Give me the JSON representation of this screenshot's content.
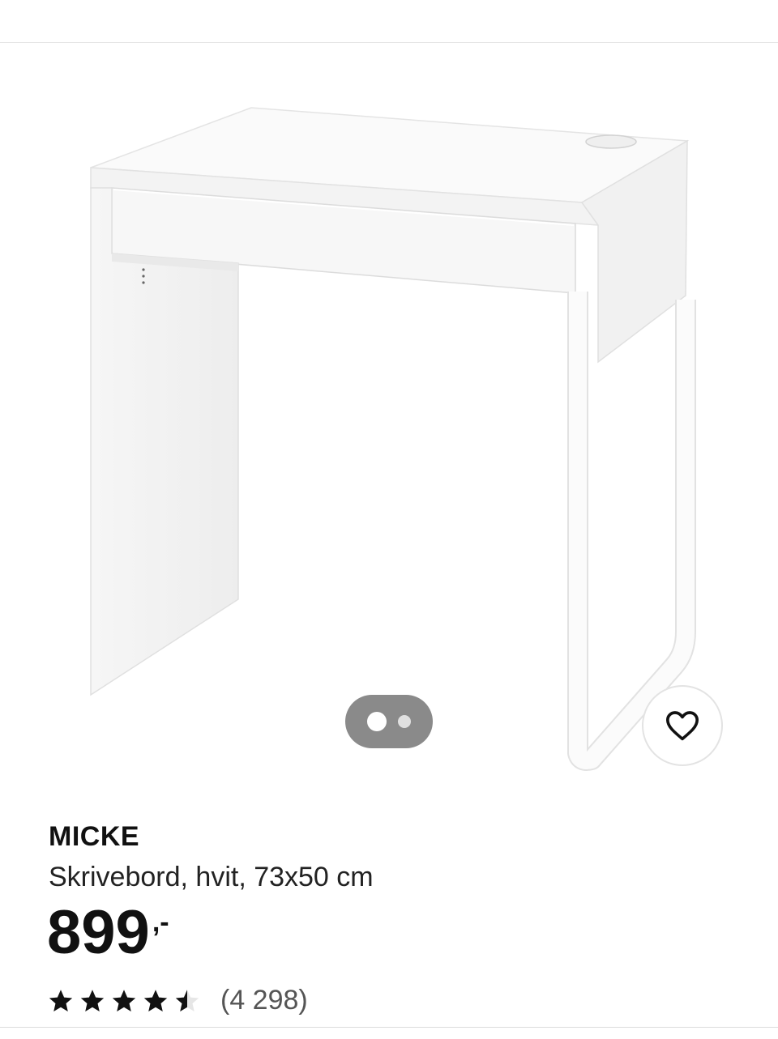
{
  "product": {
    "name": "MICKE",
    "description": "Skrivebord, hvit, 73x50 cm",
    "price": {
      "amount": "899",
      "suffix": ",-"
    },
    "rating": {
      "value": 4.5,
      "max": 5,
      "review_count": "(4 298)"
    }
  },
  "gallery": {
    "image_count": 2,
    "active_index": 0
  },
  "icons": {
    "favorite": "heart-icon",
    "star": "star-icon"
  },
  "colors": {
    "star": "#111111",
    "pager_background": "#8a8a8a"
  }
}
